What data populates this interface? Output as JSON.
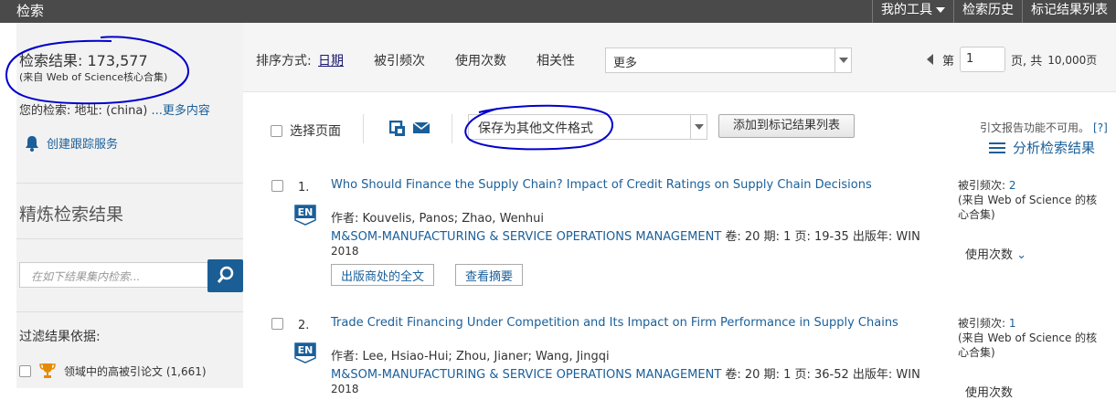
{
  "topbar": {
    "title": "检索",
    "nav": [
      "我的工具",
      "检索历史",
      "标记结果列表"
    ]
  },
  "sidebar": {
    "result_label": "检索结果: 173,577",
    "result_source": "(来自 Web of Science核心合集)",
    "your_search": "您的检索: 地址: (china) ",
    "more_content": "...更多内容",
    "alert_label": "创建跟踪服务",
    "refine_title": "精炼检索结果",
    "refine_placeholder": "在如下结果集内检索...",
    "filter_title": "过滤结果依据:",
    "filter_item": "领域中的高被引论文 (1,661)"
  },
  "sortbar": {
    "label": "排序方式:",
    "options": [
      "日期",
      "被引频次",
      "使用次数",
      "相关性"
    ],
    "more_select": "更多",
    "pager_prefix": "第",
    "page_value": "1",
    "pager_suffix": "页, 共",
    "total_pages": "10,000页"
  },
  "toolbar": {
    "select_page": "选择页面",
    "save_format": "保存为其他文件格式",
    "add_to_marked": "添加到标记结果列表",
    "cite_unavailable": "引文报告功能不可用。",
    "help": "[?]",
    "analyze": "分析检索结果"
  },
  "records": [
    {
      "num": "1.",
      "title": "Who Should Finance the Supply Chain? Impact of Credit Ratings on Supply Chain Decisions",
      "badge": "EN",
      "authors": "作者: Kouvelis, Panos; Zhao, Wenhui",
      "journal": "M&SOM-MANUFACTURING & SERVICE OPERATIONS MANAGEMENT",
      "details": " 卷: 20  期: 1  页: 19-35  出版年: WIN",
      "year": "2018",
      "btn_fulltext": "出版商处的全文",
      "btn_abstract": "查看摘要",
      "cite_label": "被引频次: ",
      "cite_count": "2",
      "cite_source": "(来自 Web of Science 的核心合集)",
      "usage": "使用次数"
    },
    {
      "num": "2.",
      "title": "Trade Credit Financing Under Competition and Its Impact on Firm Performance in Supply Chains",
      "badge": "EN",
      "authors": "作者: Lee, Hsiao-Hui; Zhou, Jianer; Wang, Jingqi",
      "journal": "M&SOM-MANUFACTURING & SERVICE OPERATIONS MANAGEMENT",
      "details": " 卷: 20  期: 1  页: 36-52  出版年: WIN",
      "year": "2018",
      "cite_label": "被引频次: ",
      "cite_count": "1",
      "cite_source": "(来自 Web of Science 的核心合集)",
      "usage": "使用次数"
    }
  ],
  "colors": {
    "topbar": "#4a4a4a",
    "link": "#1a5f99",
    "annotation": "#0000cc",
    "search_button": "#1b5e96"
  }
}
